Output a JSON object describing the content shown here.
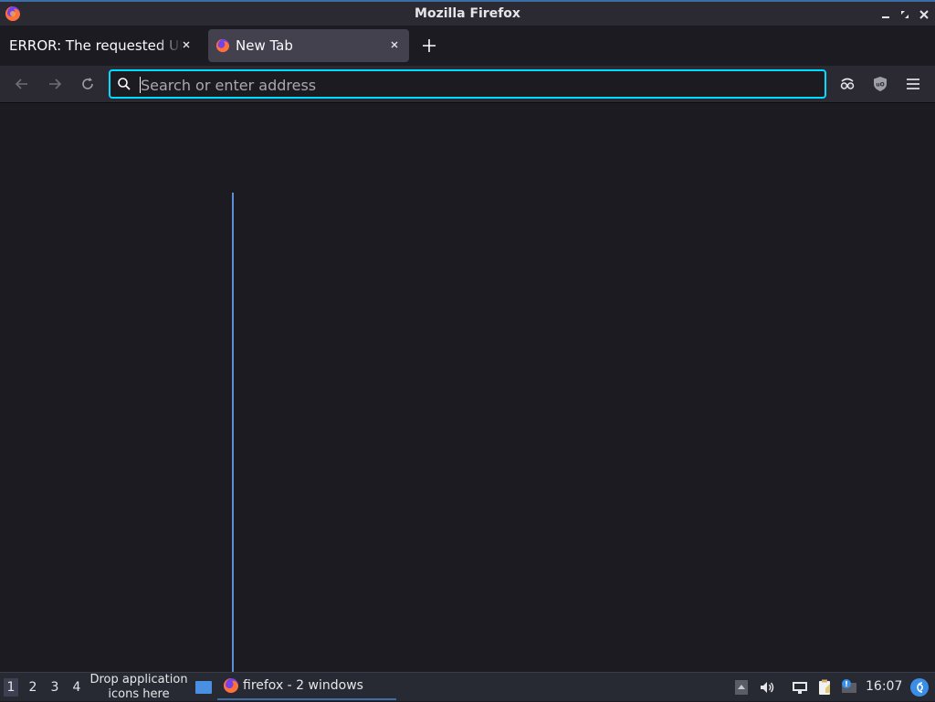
{
  "window": {
    "title": "Mozilla Firefox",
    "controls": [
      "minimize",
      "maximize",
      "close"
    ]
  },
  "tabs": [
    {
      "label": "ERROR: The requested URL could not be retrieved",
      "active": false
    },
    {
      "label": "New Tab",
      "active": true
    }
  ],
  "navbar": {
    "url_placeholder": "Search or enter address",
    "url_value": ""
  },
  "taskbar": {
    "workspaces": [
      "1",
      "2",
      "3",
      "4"
    ],
    "active_workspace": "1",
    "drop_text": "Drop application icons here",
    "task_label": "firefox - 2 windows",
    "clock": "16:07"
  },
  "colors": {
    "accent": "#00ddff",
    "content_bg": "#1c1b22",
    "toolbar_bg": "#2b2a33",
    "active_tab_bg": "#42414d",
    "taskbar_bg": "#272a33",
    "line_blue": "#5b8fd6"
  }
}
